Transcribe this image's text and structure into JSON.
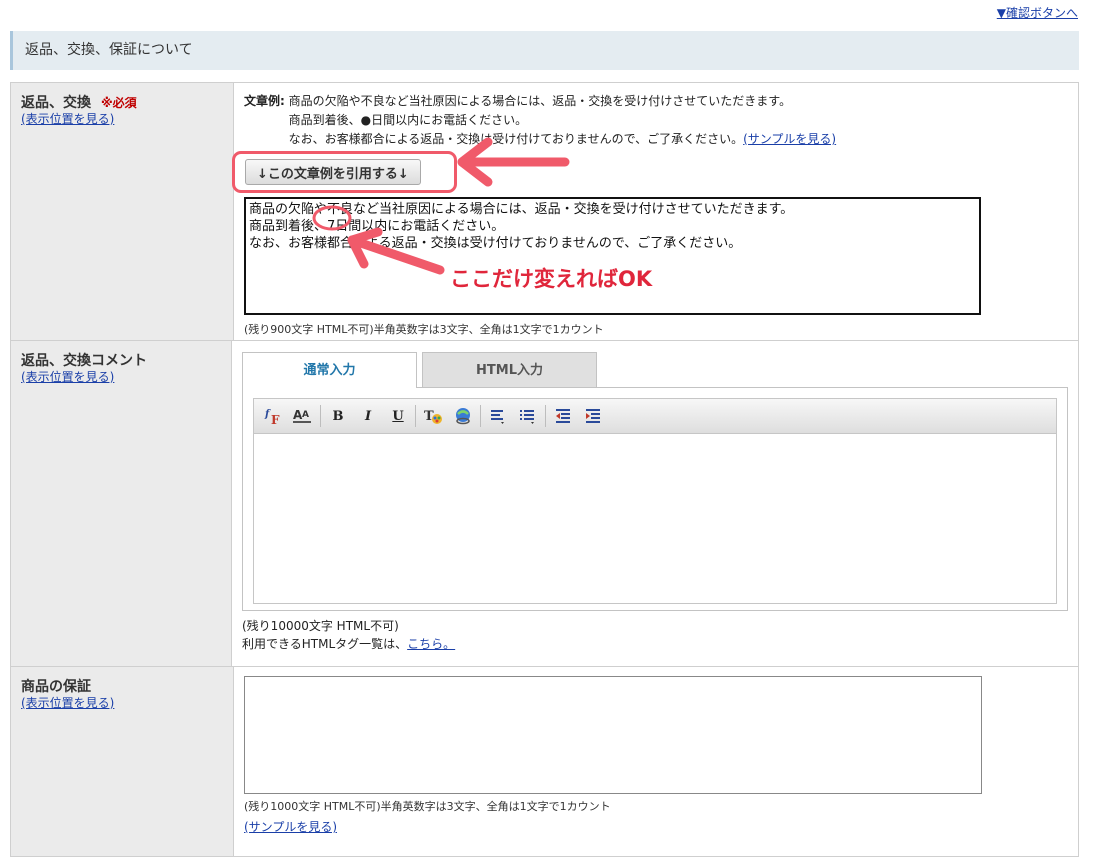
{
  "top_link": "▼確認ボタンへ",
  "section_title": "返品、交換、保証について",
  "return_exchange": {
    "label": "返品、交換",
    "required": "※必須",
    "position_link": "(表示位置を見る)",
    "example_key": "文章例:",
    "example_lines": [
      "商品の欠陥や不良など当社原因による場合には、返品・交換を受け付けさせていただきます。",
      "商品到着後、●日間以内にお電話ください。",
      "なお、お客様都合による返品・交換は受け付けておりませんので、ご了承ください。"
    ],
    "sample_link": "(サンプルを見る)",
    "quote_button": "↓この文章例を引用する↓",
    "textarea_value": "商品の欠陥や不良など当社原因による場合には、返品・交換を受け付けさせていただきます。\n商品到着後、7日間以内にお電話ください。\nなお、お客様都合による返品・交換は受け付けておりませんので、ご了承ください。",
    "char_note": "(残り900文字 HTML不可)半角英数字は3文字、全角は1文字で1カウント"
  },
  "return_comment": {
    "label": "返品、交換コメント",
    "position_link": "(表示位置を見る)",
    "tabs": [
      "通常入力",
      "HTML入力"
    ],
    "toolbar_icons": [
      "font-face-icon",
      "font-size-icon",
      "bold-icon",
      "italic-icon",
      "underline-icon",
      "text-color-icon",
      "link-icon",
      "align-icon",
      "list-icon",
      "outdent-icon",
      "indent-icon"
    ],
    "toolbar_labels": {
      "bold": "B",
      "italic": "I",
      "underline": "U"
    },
    "char_note": "(残り10000文字 HTML不可)",
    "html_tags_text": "利用できるHTMLタグ一覧は、",
    "html_tags_link": "こちら。"
  },
  "warranty": {
    "label": "商品の保証",
    "position_link": "(表示位置を見る)",
    "char_note": "(残り1000文字 HTML不可)半角英数字は3文字、全角は1文字で1カウント",
    "sample_link": "(サンプルを見る)"
  },
  "annotation": {
    "text": "ここだけ変えればOK",
    "color": "#e0263b"
  }
}
